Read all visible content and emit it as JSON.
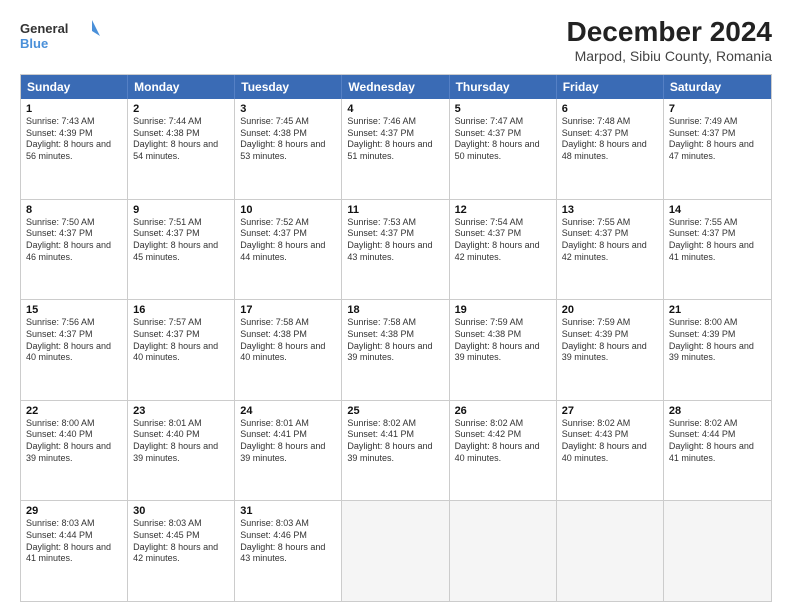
{
  "header": {
    "logo_general": "General",
    "logo_blue": "Blue",
    "main_title": "December 2024",
    "subtitle": "Marpod, Sibiu County, Romania"
  },
  "calendar": {
    "days_of_week": [
      "Sunday",
      "Monday",
      "Tuesday",
      "Wednesday",
      "Thursday",
      "Friday",
      "Saturday"
    ],
    "weeks": [
      [
        {
          "day": "",
          "empty": true
        },
        {
          "day": "",
          "empty": true
        },
        {
          "day": "",
          "empty": true
        },
        {
          "day": "",
          "empty": true
        },
        {
          "day": "",
          "empty": true
        },
        {
          "day": "",
          "empty": true
        },
        {
          "day": "",
          "empty": true
        }
      ],
      [
        {
          "num": "1",
          "sunrise": "Sunrise: 7:43 AM",
          "sunset": "Sunset: 4:39 PM",
          "daylight": "Daylight: 8 hours and 56 minutes."
        },
        {
          "num": "2",
          "sunrise": "Sunrise: 7:44 AM",
          "sunset": "Sunset: 4:38 PM",
          "daylight": "Daylight: 8 hours and 54 minutes."
        },
        {
          "num": "3",
          "sunrise": "Sunrise: 7:45 AM",
          "sunset": "Sunset: 4:38 PM",
          "daylight": "Daylight: 8 hours and 53 minutes."
        },
        {
          "num": "4",
          "sunrise": "Sunrise: 7:46 AM",
          "sunset": "Sunset: 4:37 PM",
          "daylight": "Daylight: 8 hours and 51 minutes."
        },
        {
          "num": "5",
          "sunrise": "Sunrise: 7:47 AM",
          "sunset": "Sunset: 4:37 PM",
          "daylight": "Daylight: 8 hours and 50 minutes."
        },
        {
          "num": "6",
          "sunrise": "Sunrise: 7:48 AM",
          "sunset": "Sunset: 4:37 PM",
          "daylight": "Daylight: 8 hours and 48 minutes."
        },
        {
          "num": "7",
          "sunrise": "Sunrise: 7:49 AM",
          "sunset": "Sunset: 4:37 PM",
          "daylight": "Daylight: 8 hours and 47 minutes."
        }
      ],
      [
        {
          "num": "8",
          "sunrise": "Sunrise: 7:50 AM",
          "sunset": "Sunset: 4:37 PM",
          "daylight": "Daylight: 8 hours and 46 minutes."
        },
        {
          "num": "9",
          "sunrise": "Sunrise: 7:51 AM",
          "sunset": "Sunset: 4:37 PM",
          "daylight": "Daylight: 8 hours and 45 minutes."
        },
        {
          "num": "10",
          "sunrise": "Sunrise: 7:52 AM",
          "sunset": "Sunset: 4:37 PM",
          "daylight": "Daylight: 8 hours and 44 minutes."
        },
        {
          "num": "11",
          "sunrise": "Sunrise: 7:53 AM",
          "sunset": "Sunset: 4:37 PM",
          "daylight": "Daylight: 8 hours and 43 minutes."
        },
        {
          "num": "12",
          "sunrise": "Sunrise: 7:54 AM",
          "sunset": "Sunset: 4:37 PM",
          "daylight": "Daylight: 8 hours and 42 minutes."
        },
        {
          "num": "13",
          "sunrise": "Sunrise: 7:55 AM",
          "sunset": "Sunset: 4:37 PM",
          "daylight": "Daylight: 8 hours and 42 minutes."
        },
        {
          "num": "14",
          "sunrise": "Sunrise: 7:55 AM",
          "sunset": "Sunset: 4:37 PM",
          "daylight": "Daylight: 8 hours and 41 minutes."
        }
      ],
      [
        {
          "num": "15",
          "sunrise": "Sunrise: 7:56 AM",
          "sunset": "Sunset: 4:37 PM",
          "daylight": "Daylight: 8 hours and 40 minutes."
        },
        {
          "num": "16",
          "sunrise": "Sunrise: 7:57 AM",
          "sunset": "Sunset: 4:37 PM",
          "daylight": "Daylight: 8 hours and 40 minutes."
        },
        {
          "num": "17",
          "sunrise": "Sunrise: 7:58 AM",
          "sunset": "Sunset: 4:38 PM",
          "daylight": "Daylight: 8 hours and 40 minutes."
        },
        {
          "num": "18",
          "sunrise": "Sunrise: 7:58 AM",
          "sunset": "Sunset: 4:38 PM",
          "daylight": "Daylight: 8 hours and 39 minutes."
        },
        {
          "num": "19",
          "sunrise": "Sunrise: 7:59 AM",
          "sunset": "Sunset: 4:38 PM",
          "daylight": "Daylight: 8 hours and 39 minutes."
        },
        {
          "num": "20",
          "sunrise": "Sunrise: 7:59 AM",
          "sunset": "Sunset: 4:39 PM",
          "daylight": "Daylight: 8 hours and 39 minutes."
        },
        {
          "num": "21",
          "sunrise": "Sunrise: 8:00 AM",
          "sunset": "Sunset: 4:39 PM",
          "daylight": "Daylight: 8 hours and 39 minutes."
        }
      ],
      [
        {
          "num": "22",
          "sunrise": "Sunrise: 8:00 AM",
          "sunset": "Sunset: 4:40 PM",
          "daylight": "Daylight: 8 hours and 39 minutes."
        },
        {
          "num": "23",
          "sunrise": "Sunrise: 8:01 AM",
          "sunset": "Sunset: 4:40 PM",
          "daylight": "Daylight: 8 hours and 39 minutes."
        },
        {
          "num": "24",
          "sunrise": "Sunrise: 8:01 AM",
          "sunset": "Sunset: 4:41 PM",
          "daylight": "Daylight: 8 hours and 39 minutes."
        },
        {
          "num": "25",
          "sunrise": "Sunrise: 8:02 AM",
          "sunset": "Sunset: 4:41 PM",
          "daylight": "Daylight: 8 hours and 39 minutes."
        },
        {
          "num": "26",
          "sunrise": "Sunrise: 8:02 AM",
          "sunset": "Sunset: 4:42 PM",
          "daylight": "Daylight: 8 hours and 40 minutes."
        },
        {
          "num": "27",
          "sunrise": "Sunrise: 8:02 AM",
          "sunset": "Sunset: 4:43 PM",
          "daylight": "Daylight: 8 hours and 40 minutes."
        },
        {
          "num": "28",
          "sunrise": "Sunrise: 8:02 AM",
          "sunset": "Sunset: 4:44 PM",
          "daylight": "Daylight: 8 hours and 41 minutes."
        }
      ],
      [
        {
          "num": "29",
          "sunrise": "Sunrise: 8:03 AM",
          "sunset": "Sunset: 4:44 PM",
          "daylight": "Daylight: 8 hours and 41 minutes."
        },
        {
          "num": "30",
          "sunrise": "Sunrise: 8:03 AM",
          "sunset": "Sunset: 4:45 PM",
          "daylight": "Daylight: 8 hours and 42 minutes."
        },
        {
          "num": "31",
          "sunrise": "Sunrise: 8:03 AM",
          "sunset": "Sunset: 4:46 PM",
          "daylight": "Daylight: 8 hours and 43 minutes."
        },
        {
          "day": "",
          "empty": true
        },
        {
          "day": "",
          "empty": true
        },
        {
          "day": "",
          "empty": true
        },
        {
          "day": "",
          "empty": true
        }
      ]
    ]
  }
}
